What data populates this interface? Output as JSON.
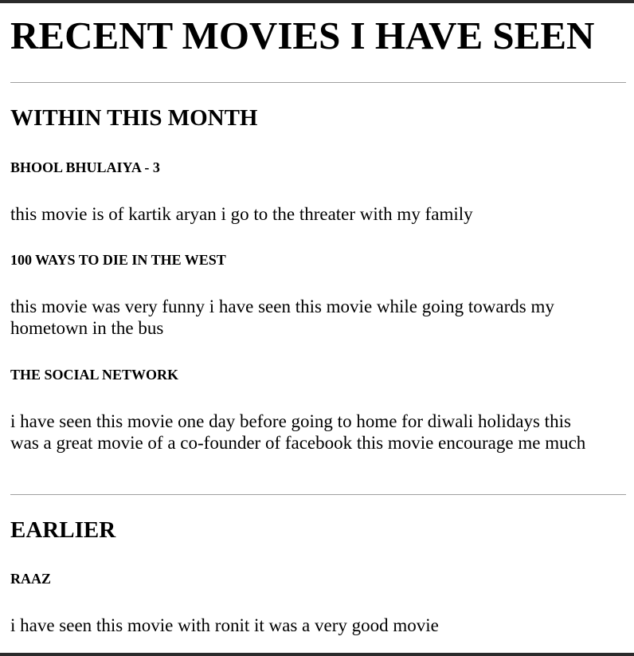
{
  "page_title": "RECENT MOVIES I HAVE SEEN",
  "sections": [
    {
      "heading": "WITHIN THIS MONTH",
      "movies": [
        {
          "title": "BHOOL BHULAIYA - 3",
          "description": "this movie is of kartik aryan i go to the threater with my family"
        },
        {
          "title": "100 WAYS TO DIE IN THE WEST",
          "description": "this movie was very funny i have seen this movie while going towards my hometown in the bus"
        },
        {
          "title": "THE SOCIAL NETWORK",
          "description": "i have seen this movie one day before going to home for diwali holidays this was a great movie of a co-founder of facebook this movie encourage me much"
        }
      ]
    },
    {
      "heading": "EARLIER",
      "movies": [
        {
          "title": "RAAZ",
          "description": "i have seen this movie with ronit it was a very good movie"
        }
      ]
    }
  ]
}
